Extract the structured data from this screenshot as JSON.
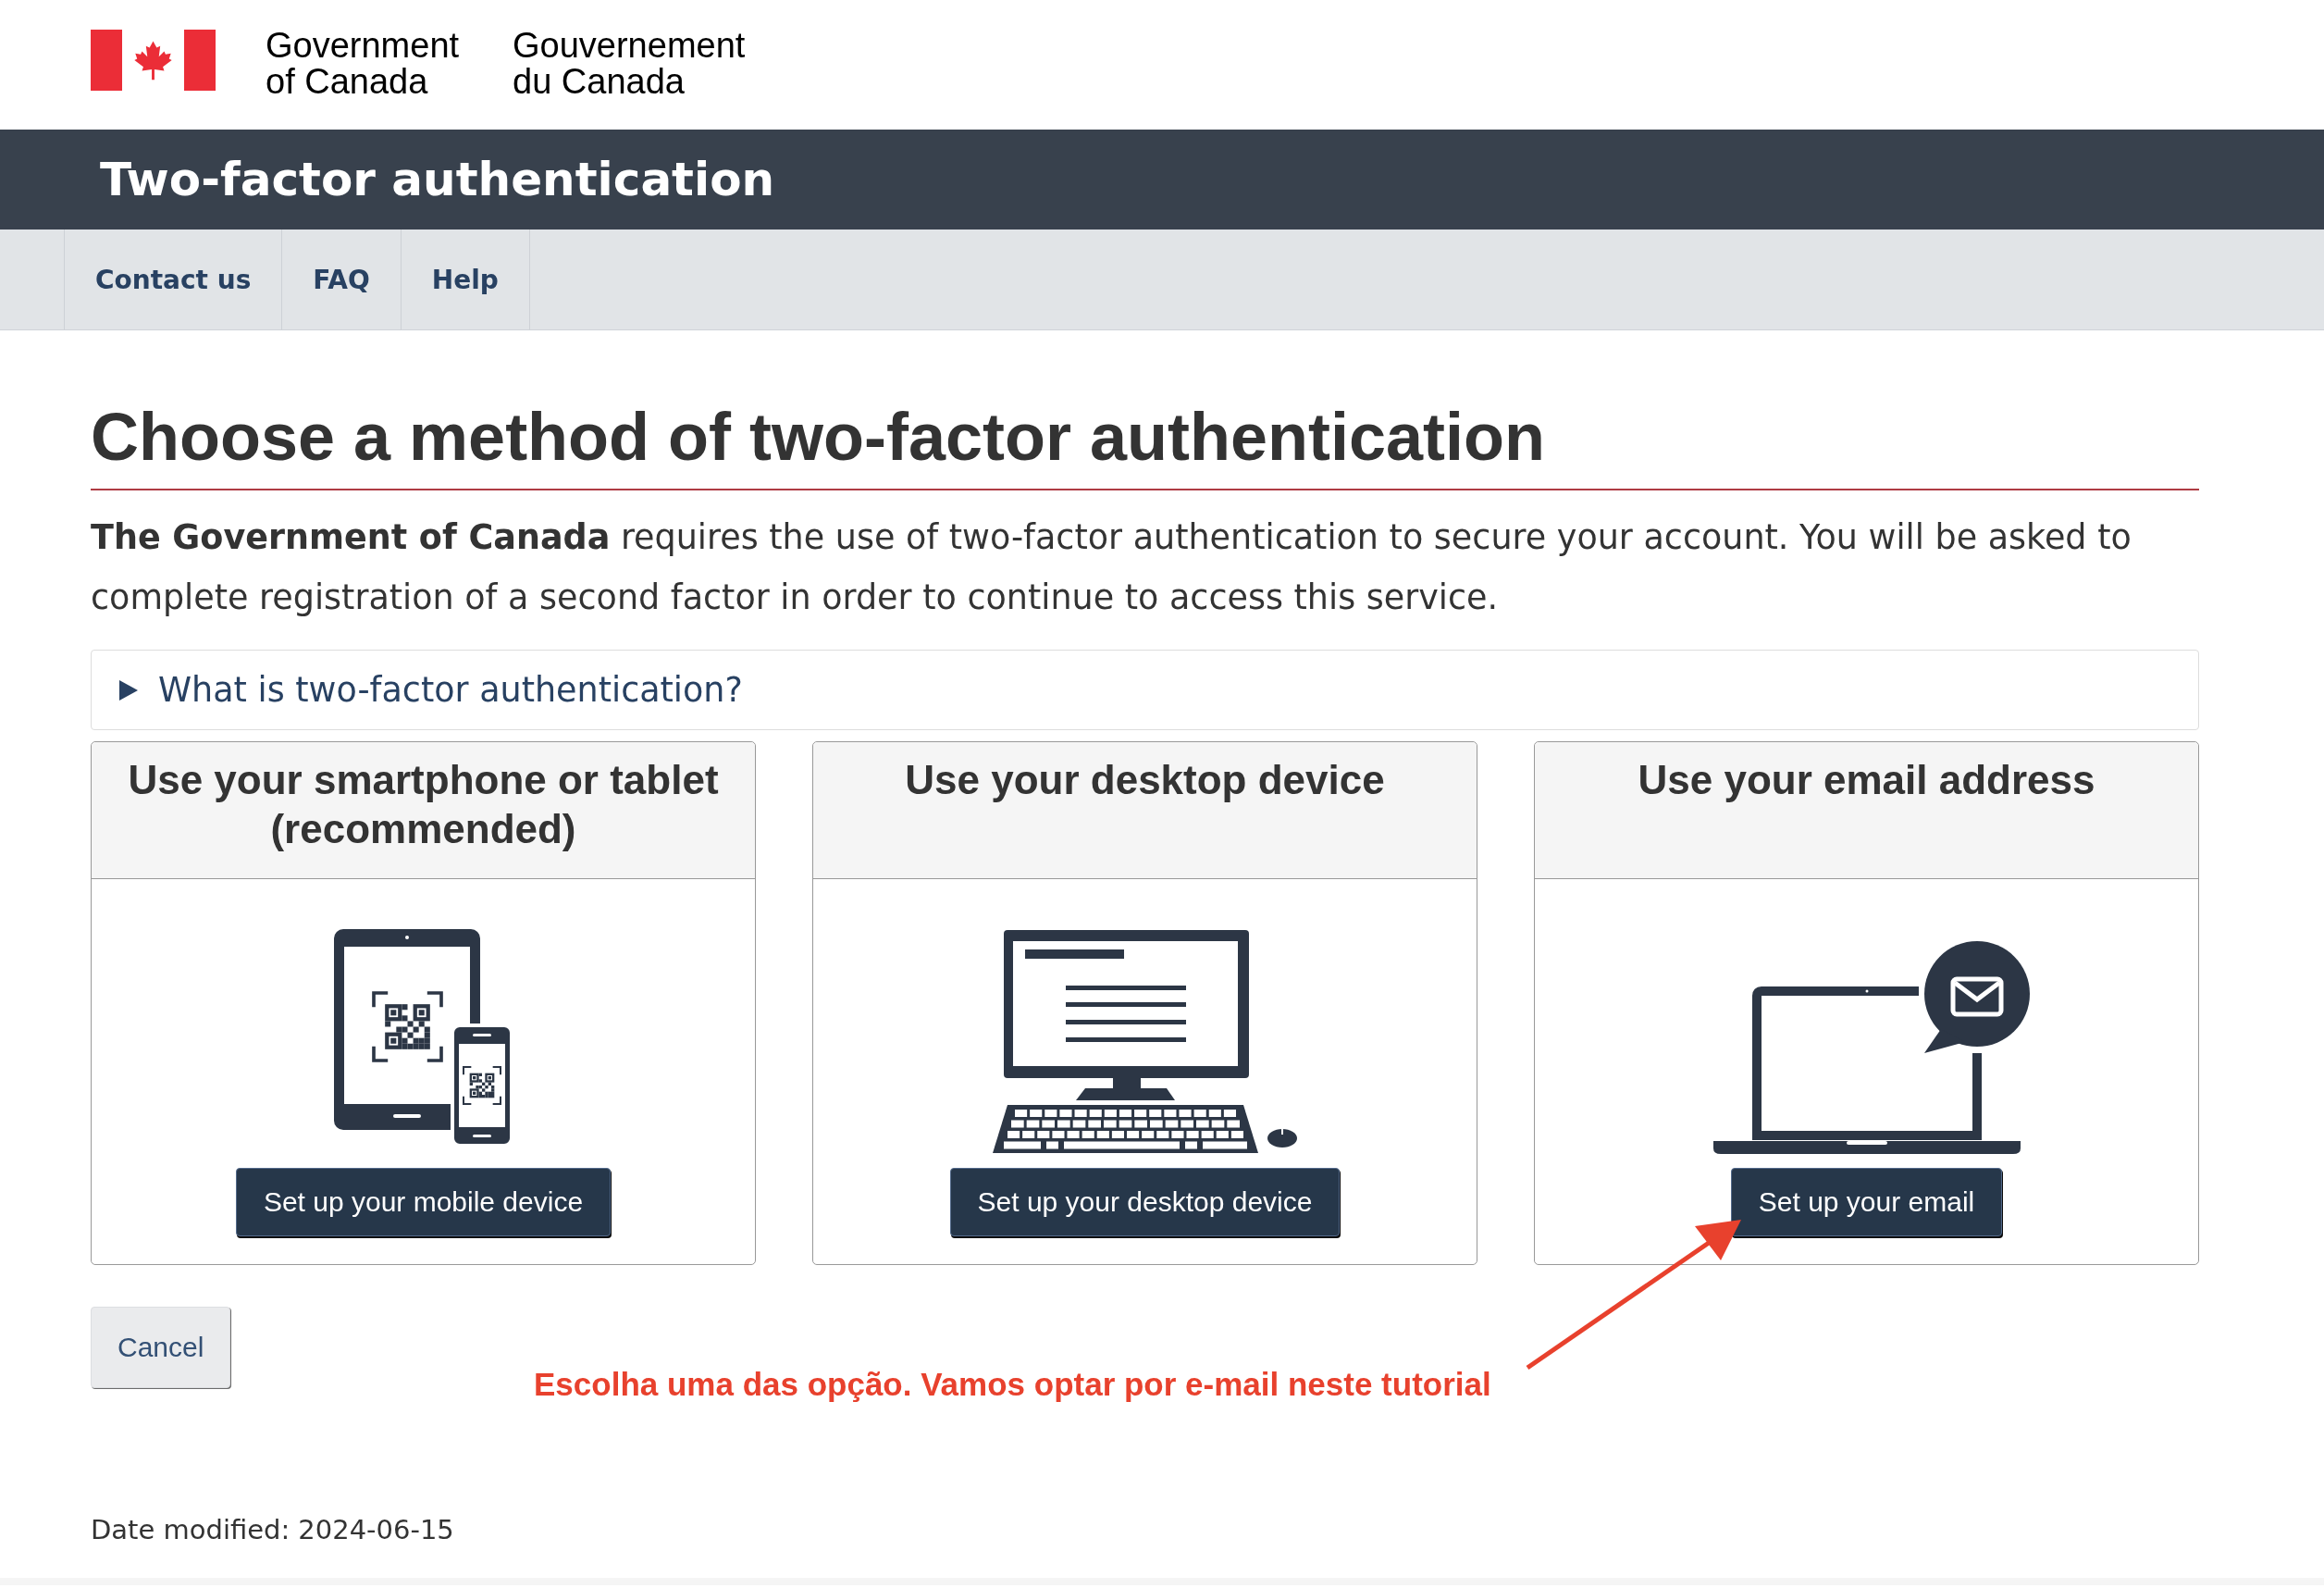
{
  "header": {
    "wordmark": [
      {
        "lines": [
          "Government",
          "of Canada"
        ]
      },
      {
        "lines": [
          "Gouvernement",
          "du Canada"
        ]
      }
    ]
  },
  "app_bar": {
    "title": "Two-factor authentication"
  },
  "nav": {
    "items": [
      {
        "label": "Contact us"
      },
      {
        "label": "FAQ"
      },
      {
        "label": "Help"
      }
    ]
  },
  "main": {
    "heading": "Choose a method of two-factor authentication",
    "intro": "**The Government of Canada** requires the use of two-factor authentication to secure your account. You will be asked to complete registration of a second factor in order to continue to access this service.",
    "details": {
      "summary": "What is two-factor authentication?",
      "expanded": false
    },
    "methods": [
      {
        "kind": "mobile",
        "title": "Use your smartphone or tablet (recommended)",
        "button": "Set up your mobile device"
      },
      {
        "kind": "desktop",
        "title": "Use your desktop device",
        "button": "Set up your desktop device"
      },
      {
        "kind": "email",
        "title": "Use your email address",
        "button": "Set up your email"
      }
    ],
    "cancel_button": "Cancel"
  },
  "annotation": {
    "text": "Escolha uma das opção. Vamos optar por e-mail neste tutorial"
  },
  "date_modified": {
    "label": "Date modified:",
    "value": "2024-06-15"
  }
}
